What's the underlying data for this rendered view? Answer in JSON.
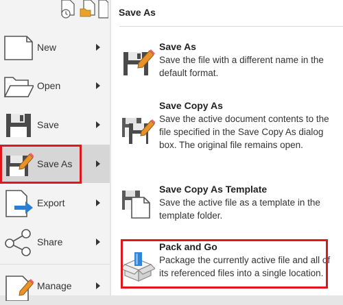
{
  "menu": {
    "items": [
      {
        "id": "new",
        "label": "New"
      },
      {
        "id": "open",
        "label": "Open"
      },
      {
        "id": "save",
        "label": "Save"
      },
      {
        "id": "save-as",
        "label": "Save As"
      },
      {
        "id": "export",
        "label": "Export"
      },
      {
        "id": "share",
        "label": "Share"
      },
      {
        "id": "manage",
        "label": "Manage"
      }
    ],
    "active": "save-as"
  },
  "panel": {
    "title": "Save As",
    "options": [
      {
        "title": "Save As",
        "description": "Save the file with a different name in the default format."
      },
      {
        "title": "Save Copy As",
        "description": "Save the active document contents to the file specified in the Save Copy As dialog box. The original file remains open."
      },
      {
        "title": "Save Copy As Template",
        "description": "Save the active file as a template in the template folder."
      },
      {
        "title": "Pack and Go",
        "description": "Package the currently active file and all of its referenced files into a single location."
      }
    ]
  },
  "colors": {
    "highlight": "#e0161f",
    "accent_orange": "#e8922a",
    "export_arrow": "#2a7fd4",
    "pack_blue": "#2f86d8"
  },
  "icons": [
    "recent-documents-icon",
    "open-folder-icon",
    "new-file-icon",
    "folder-open-icon",
    "floppy-disk-icon",
    "floppy-pencil-icon",
    "export-arrow-icon",
    "share-nodes-icon",
    "manage-file-icon",
    "save-copy-icon",
    "template-file-icon",
    "pack-box-icon"
  ]
}
